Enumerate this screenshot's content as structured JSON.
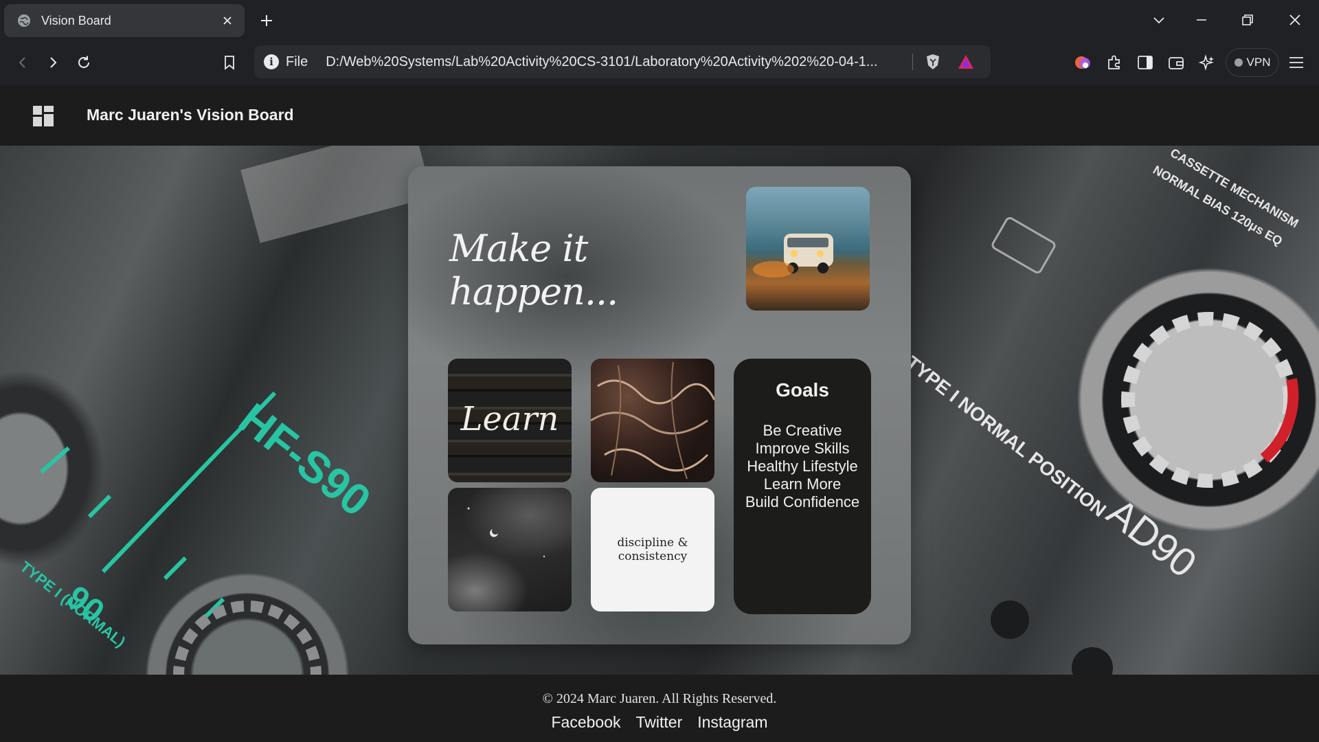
{
  "browser": {
    "tab_title": "Vision Board",
    "info_label": "File",
    "url": "D:/Web%20Systems/Lab%20Activity%20CS-3101/Laboratory%20Activity%202%20-04-1...",
    "vpn_label": "VPN",
    "icons": [
      "globe-icon",
      "close-icon",
      "plus-icon",
      "chevron-down-icon",
      "minimize-icon",
      "restore-icon",
      "window-close-icon",
      "back-icon",
      "forward-icon",
      "reload-icon",
      "bookmark-icon",
      "brave-shield-icon",
      "brave-rewards-icon",
      "extension-color-icon",
      "puzzle-icon",
      "sidebar-icon",
      "wallet-icon",
      "leo-ai-icon",
      "menu-icon"
    ]
  },
  "header": {
    "title": "Marc Juaren's Vision Board"
  },
  "hero": {
    "deco_texts": [
      "HF-S90",
      "90",
      "TYPE I (NORMAL)",
      "TYPE I NORMAL POSITION",
      "AD90",
      "CASSETTE MECHANISM",
      "NORMAL BIAS 120μs EQ"
    ]
  },
  "board": {
    "tagline": "Make it happen...",
    "learn_text": "Learn",
    "discipline_text": "discipline & consistency",
    "goals_title": "Goals",
    "goals": [
      "Be Creative",
      "Improve Skills",
      "Healthy Lifestyle",
      "Learn More",
      "Build Confidence"
    ]
  },
  "footer": {
    "copyright": "© 2024 Marc Juaren. All Rights Reserved.",
    "links": [
      "Facebook",
      "Twitter",
      "Instagram"
    ]
  },
  "colors": {
    "chrome_bg": "#202124",
    "tab_bg": "#35363a",
    "site_bar_bg": "#1b1c1b",
    "teal_accent": "#27c5a3",
    "goals_bg": "#1c1d1b"
  }
}
